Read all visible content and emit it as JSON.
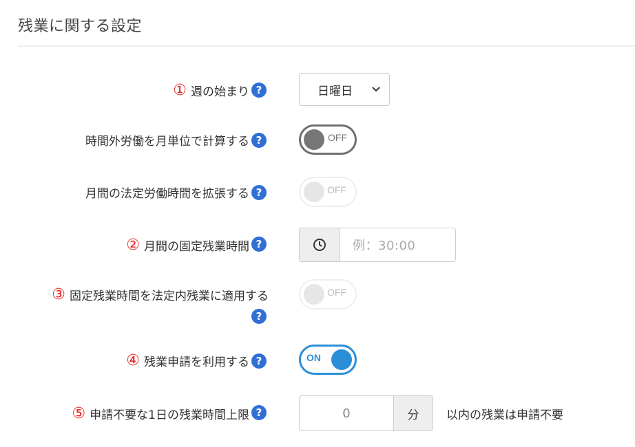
{
  "section": {
    "title": "残業に関する設定"
  },
  "rows": [
    {
      "number": "①",
      "label": "週の始まり",
      "select_value": "日曜日"
    },
    {
      "number": "",
      "label": "時間外労働を月単位で計算する",
      "toggle_text": "OFF"
    },
    {
      "number": "",
      "label": "月間の法定労働時間を拡張する",
      "toggle_text": "OFF"
    },
    {
      "number": "②",
      "label": "月間の固定残業時間",
      "placeholder": "例：30:00"
    },
    {
      "number": "③",
      "label": "固定残業時間を法定内残業に適用する",
      "toggle_text": "OFF"
    },
    {
      "number": "④",
      "label": "残業申請を利用する",
      "toggle_text": "ON"
    },
    {
      "number": "⑤",
      "label": "申請不要な1日の残業時間上限",
      "value": "0",
      "unit": "分",
      "suffix": "以内の残業は申請不要"
    }
  ],
  "icons": {
    "help": "question-circle-icon",
    "clock": "clock-icon",
    "chevron": "chevron-down-icon"
  },
  "colors": {
    "number_red": "#e8211c",
    "help_blue": "#2f6fd6",
    "toggle_on_blue": "#2b8fd8"
  },
  "glyphs": {
    "help": "?"
  }
}
